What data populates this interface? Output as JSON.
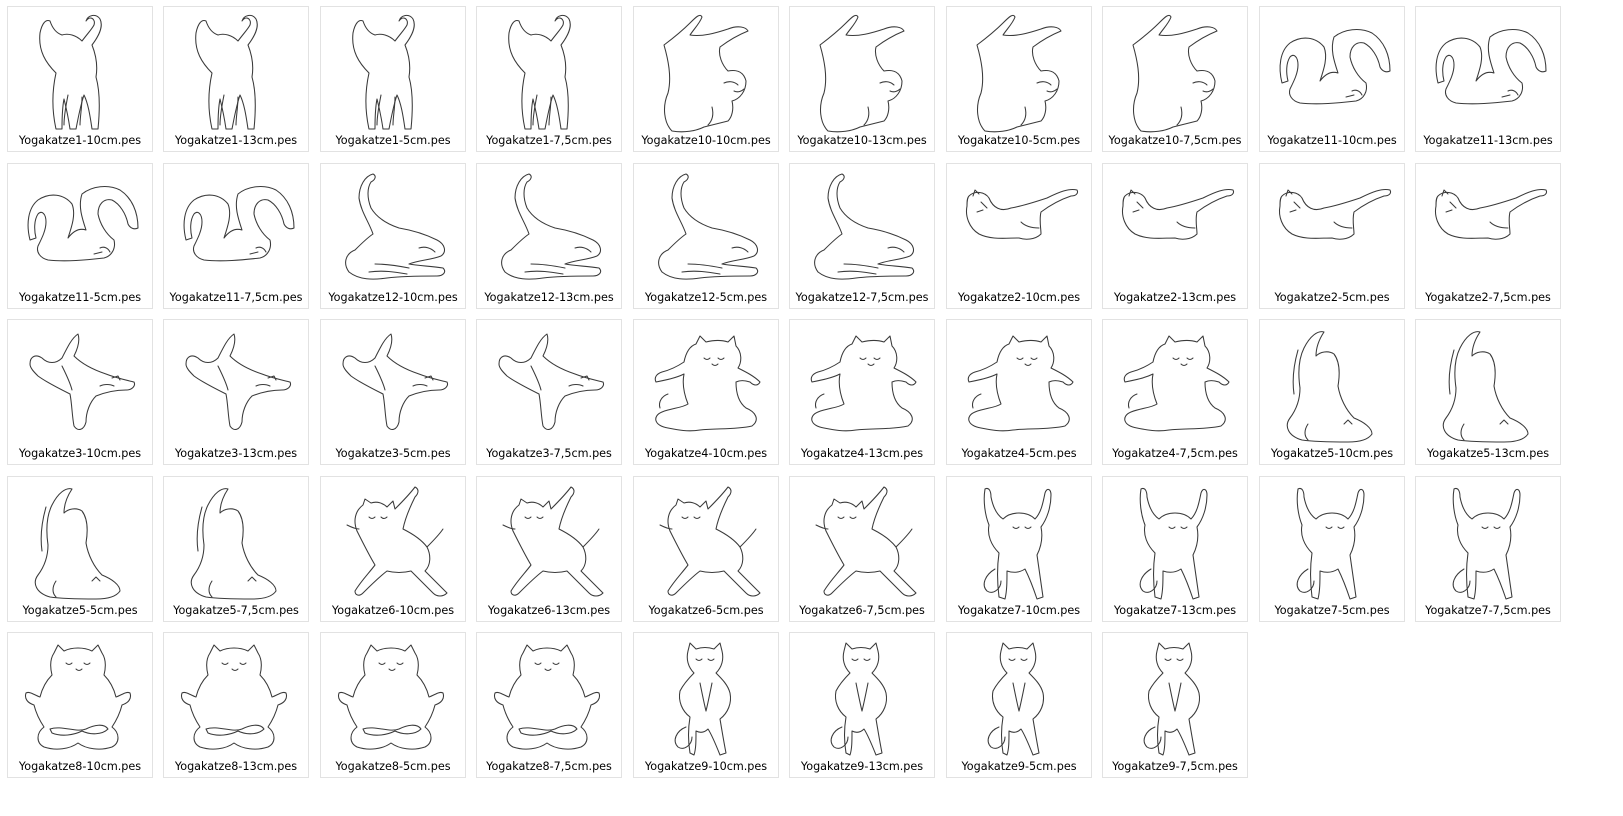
{
  "view": {
    "name": "file-grid",
    "columns": 10
  },
  "files": [
    {
      "name": "Yogakatze1-10cm.pes",
      "pose": "standing-back"
    },
    {
      "name": "Yogakatze1-13cm.pes",
      "pose": "standing-back"
    },
    {
      "name": "Yogakatze1-5cm.pes",
      "pose": "standing-back"
    },
    {
      "name": "Yogakatze1-7,5cm.pes",
      "pose": "standing-back"
    },
    {
      "name": "Yogakatze10-10cm.pes",
      "pose": "headstand"
    },
    {
      "name": "Yogakatze10-13cm.pes",
      "pose": "headstand"
    },
    {
      "name": "Yogakatze10-5cm.pes",
      "pose": "headstand"
    },
    {
      "name": "Yogakatze10-7,5cm.pes",
      "pose": "headstand"
    },
    {
      "name": "Yogakatze11-10cm.pes",
      "pose": "plough"
    },
    {
      "name": "Yogakatze11-13cm.pes",
      "pose": "plough"
    },
    {
      "name": "Yogakatze11-5cm.pes",
      "pose": "plough"
    },
    {
      "name": "Yogakatze11-7,5cm.pes",
      "pose": "plough"
    },
    {
      "name": "Yogakatze12-10cm.pes",
      "pose": "stretch"
    },
    {
      "name": "Yogakatze12-13cm.pes",
      "pose": "stretch"
    },
    {
      "name": "Yogakatze12-5cm.pes",
      "pose": "stretch"
    },
    {
      "name": "Yogakatze12-7,5cm.pes",
      "pose": "stretch"
    },
    {
      "name": "Yogakatze2-10cm.pes",
      "pose": "lying"
    },
    {
      "name": "Yogakatze2-13cm.pes",
      "pose": "lying"
    },
    {
      "name": "Yogakatze2-5cm.pes",
      "pose": "lying"
    },
    {
      "name": "Yogakatze2-7,5cm.pes",
      "pose": "lying"
    },
    {
      "name": "Yogakatze3-10cm.pes",
      "pose": "balance"
    },
    {
      "name": "Yogakatze3-13cm.pes",
      "pose": "balance"
    },
    {
      "name": "Yogakatze3-5cm.pes",
      "pose": "balance"
    },
    {
      "name": "Yogakatze3-7,5cm.pes",
      "pose": "balance"
    },
    {
      "name": "Yogakatze4-10cm.pes",
      "pose": "sitting-arms"
    },
    {
      "name": "Yogakatze4-13cm.pes",
      "pose": "sitting-arms"
    },
    {
      "name": "Yogakatze4-5cm.pes",
      "pose": "sitting-arms"
    },
    {
      "name": "Yogakatze4-7,5cm.pes",
      "pose": "sitting-arms"
    },
    {
      "name": "Yogakatze5-10cm.pes",
      "pose": "sitting-tall"
    },
    {
      "name": "Yogakatze5-13cm.pes",
      "pose": "sitting-tall"
    },
    {
      "name": "Yogakatze5-5cm.pes",
      "pose": "sitting-tall"
    },
    {
      "name": "Yogakatze5-7,5cm.pes",
      "pose": "sitting-tall"
    },
    {
      "name": "Yogakatze6-10cm.pes",
      "pose": "warrior"
    },
    {
      "name": "Yogakatze6-13cm.pes",
      "pose": "warrior"
    },
    {
      "name": "Yogakatze6-5cm.pes",
      "pose": "warrior"
    },
    {
      "name": "Yogakatze6-7,5cm.pes",
      "pose": "warrior"
    },
    {
      "name": "Yogakatze7-10cm.pes",
      "pose": "tree-arms-up"
    },
    {
      "name": "Yogakatze7-13cm.pes",
      "pose": "tree-arms-up"
    },
    {
      "name": "Yogakatze7-5cm.pes",
      "pose": "tree-arms-up"
    },
    {
      "name": "Yogakatze7-7,5cm.pes",
      "pose": "tree-arms-up"
    },
    {
      "name": "Yogakatze8-10cm.pes",
      "pose": "lotus"
    },
    {
      "name": "Yogakatze8-13cm.pes",
      "pose": "lotus"
    },
    {
      "name": "Yogakatze8-5cm.pes",
      "pose": "lotus"
    },
    {
      "name": "Yogakatze8-7,5cm.pes",
      "pose": "lotus"
    },
    {
      "name": "Yogakatze9-10cm.pes",
      "pose": "tree-praying"
    },
    {
      "name": "Yogakatze9-13cm.pes",
      "pose": "tree-praying"
    },
    {
      "name": "Yogakatze9-5cm.pes",
      "pose": "tree-praying"
    },
    {
      "name": "Yogakatze9-7,5cm.pes",
      "pose": "tree-praying"
    }
  ]
}
